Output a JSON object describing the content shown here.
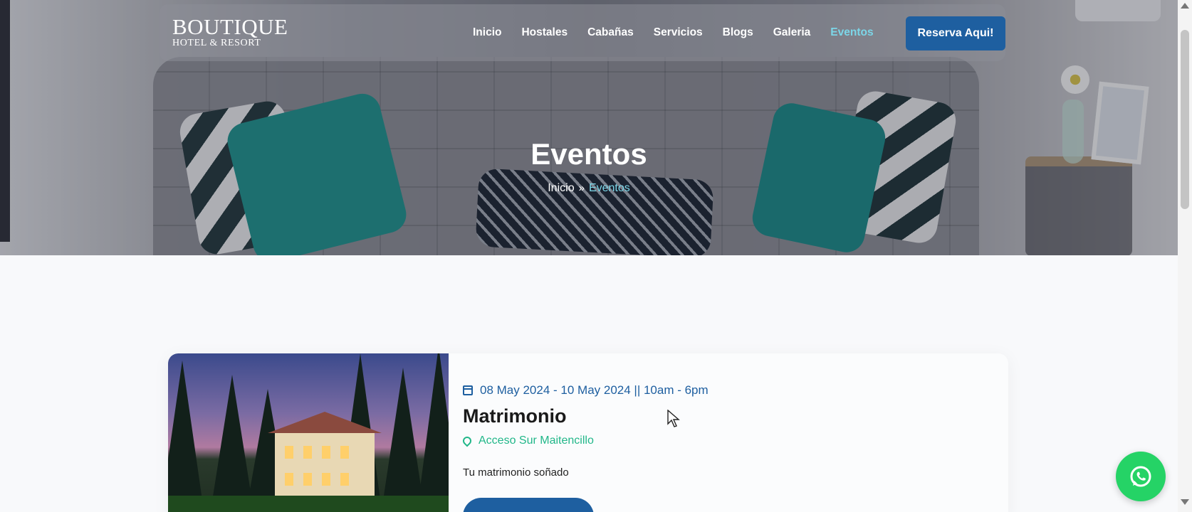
{
  "brand": {
    "line1": "BOUTIQUE",
    "line2": "HOTEL & RESORT"
  },
  "nav": {
    "items": [
      {
        "label": "Inicio"
      },
      {
        "label": "Hostales"
      },
      {
        "label": "Cabañas"
      },
      {
        "label": "Servicios"
      },
      {
        "label": "Blogs"
      },
      {
        "label": "Galeria"
      },
      {
        "label": "Eventos"
      }
    ],
    "active": "Eventos",
    "cta": "Reserva Aqui!"
  },
  "hero": {
    "title": "Eventos",
    "breadcrumb": {
      "home": "Inicio",
      "separator": "»",
      "current": "Eventos"
    }
  },
  "event": {
    "date": "08 May 2024 - 10 May 2024 || 10am - 6pm",
    "title": "Matrimonio",
    "location": "Acceso Sur Maitencillo",
    "description": "Tu matrimonio soñado",
    "button": ""
  },
  "icons": {
    "calendar": "calendar-icon",
    "location": "map-pin-icon",
    "whatsapp": "whatsapp-icon"
  },
  "colors": {
    "primary": "#1e5fa0",
    "accent_active": "#7cd6e8",
    "location_green": "#21b789",
    "whatsapp": "#25d366"
  }
}
